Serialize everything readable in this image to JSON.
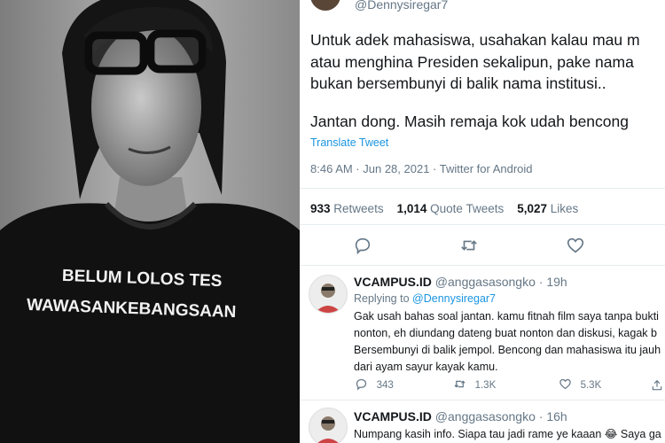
{
  "photo": {
    "shirt_line1": "BELUM LOLOS TES",
    "shirt_line2": "WAWASANKEBANGSAAN"
  },
  "tweet": {
    "handle": "@Dennysiregar7",
    "lines": [
      "Untuk adek mahasiswa, usahakan kalau mau m",
      "atau menghina Presiden sekalipun, pake nama",
      "bukan bersembunyi di balik nama institusi..",
      "Jantan dong. Masih remaja kok udah bencong"
    ],
    "translate": "Translate Tweet",
    "meta": "8:46 AM · Jun 28, 2021 · Twitter for Android",
    "retweets_count": "933",
    "retweets_label": "Retweets",
    "quotes_count": "1,014",
    "quotes_label": "Quote Tweets",
    "likes_count": "5,027",
    "likes_label": "Likes",
    "action_icons": [
      "reply-icon",
      "retweet-icon",
      "like-icon"
    ]
  },
  "replies": [
    {
      "name": "VCAMPUS.ID",
      "handle": "@anggasasongko",
      "time": "· 19h",
      "replying_label": "Replying to",
      "replying_handle": "@Dennysiregar7",
      "lines": [
        "Gak usah bahas soal jantan. kamu fitnah film saya tanpa bukti",
        "nonton, eh diundang dateng buat nonton dan diskusi, kagak b",
        "Bersembunyi di balik jempol. Bencong dan mahasiswa itu jauh",
        "dari ayam sayur kayak kamu."
      ],
      "reply_count": "343",
      "retweet_count": "1.3K",
      "like_count": "5.3K"
    },
    {
      "name": "VCAMPUS.ID",
      "handle": "@anggasasongko",
      "time": "· 16h",
      "lines": [
        "Numpang kasih info. Siapa tau jadi rame ye kaaan 😂 Saya ga"
      ]
    }
  ],
  "colors": {
    "link": "#1b95e0",
    "muted": "#657786",
    "text": "#14171a"
  }
}
